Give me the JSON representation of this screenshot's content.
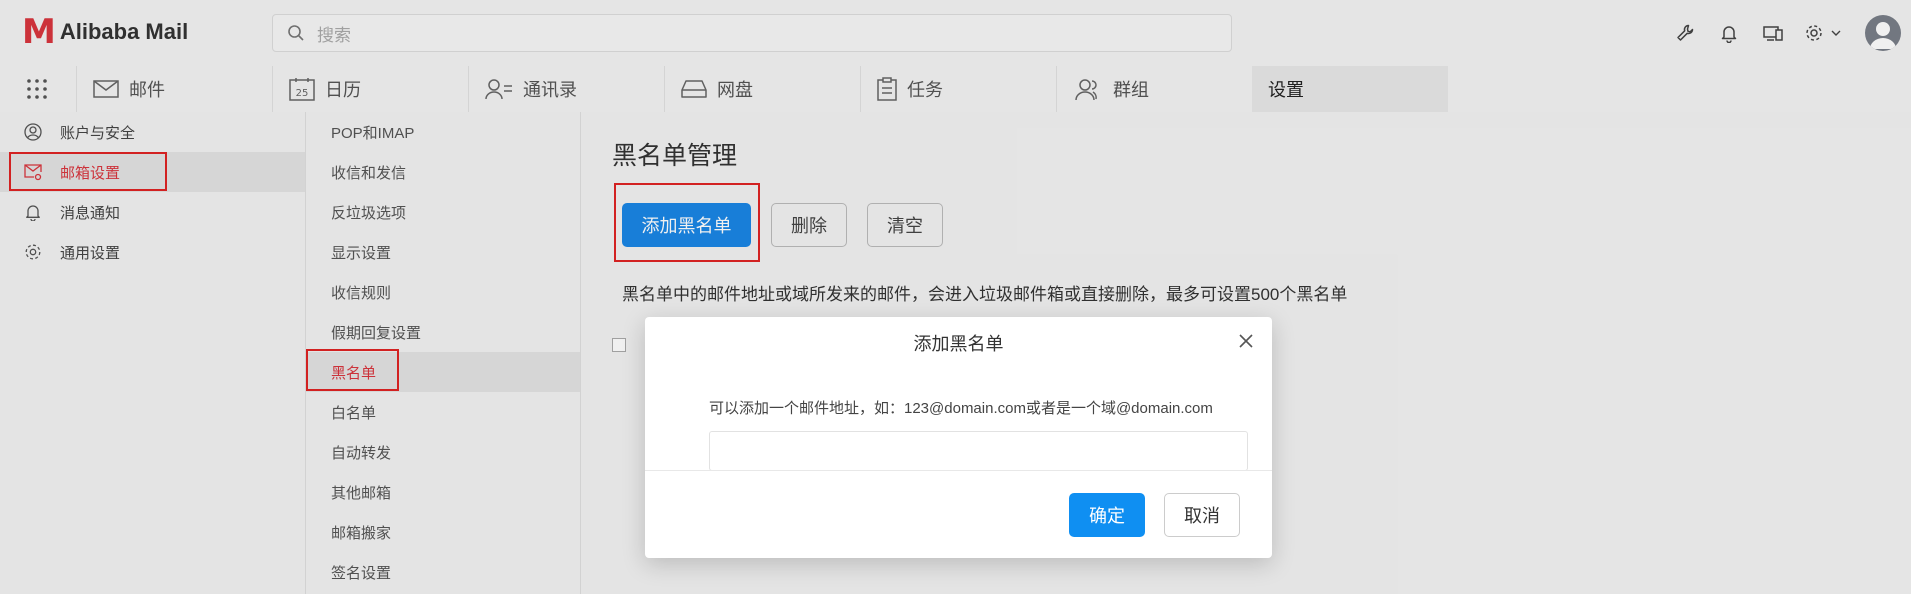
{
  "app": {
    "logo_mark": "M",
    "logo_text": "Alibaba Mail"
  },
  "search": {
    "placeholder": "搜索"
  },
  "nav": {
    "tabs": [
      {
        "label": "邮件",
        "icon": "mail-icon"
      },
      {
        "label": "日历",
        "icon": "calendar-icon",
        "icon_text": "25"
      },
      {
        "label": "通讯录",
        "icon": "contacts-icon"
      },
      {
        "label": "网盘",
        "icon": "drive-icon"
      },
      {
        "label": "任务",
        "icon": "tasks-icon"
      },
      {
        "label": "群组",
        "icon": "group-icon"
      },
      {
        "label": "设置",
        "icon": ""
      }
    ],
    "active_tab": 6
  },
  "left_nav": {
    "items": [
      {
        "label": "账户与安全",
        "icon": "user-icon"
      },
      {
        "label": "邮箱设置",
        "icon": "mail-settings-icon"
      },
      {
        "label": "消息通知",
        "icon": "bell-icon"
      },
      {
        "label": "通用设置",
        "icon": "gear-icon"
      }
    ],
    "active": 1
  },
  "sub_nav": {
    "items": [
      "POP和IMAP",
      "收信和发信",
      "反垃圾选项",
      "显示设置",
      "收信规则",
      "假期回复设置",
      "黑名单",
      "白名单",
      "自动转发",
      "其他邮箱",
      "邮箱搬家",
      "签名设置"
    ],
    "active": 6
  },
  "main": {
    "title": "黑名单管理",
    "add_button": "添加黑名单",
    "delete_button": "删除",
    "clear_button": "清空",
    "description": "黑名单中的邮件地址或域所发来的邮件，会进入垃圾邮件箱或直接删除，最多可设置500个黑名单"
  },
  "dialog": {
    "title": "添加黑名单",
    "hint": "可以添加一个邮件地址，如：123@domain.com或者是一个域@domain.com",
    "input_value": "",
    "ok": "确定",
    "cancel": "取消"
  },
  "colors": {
    "accent": "#1a86e6",
    "brand": "#d9363e",
    "highlight": "#e02424"
  }
}
